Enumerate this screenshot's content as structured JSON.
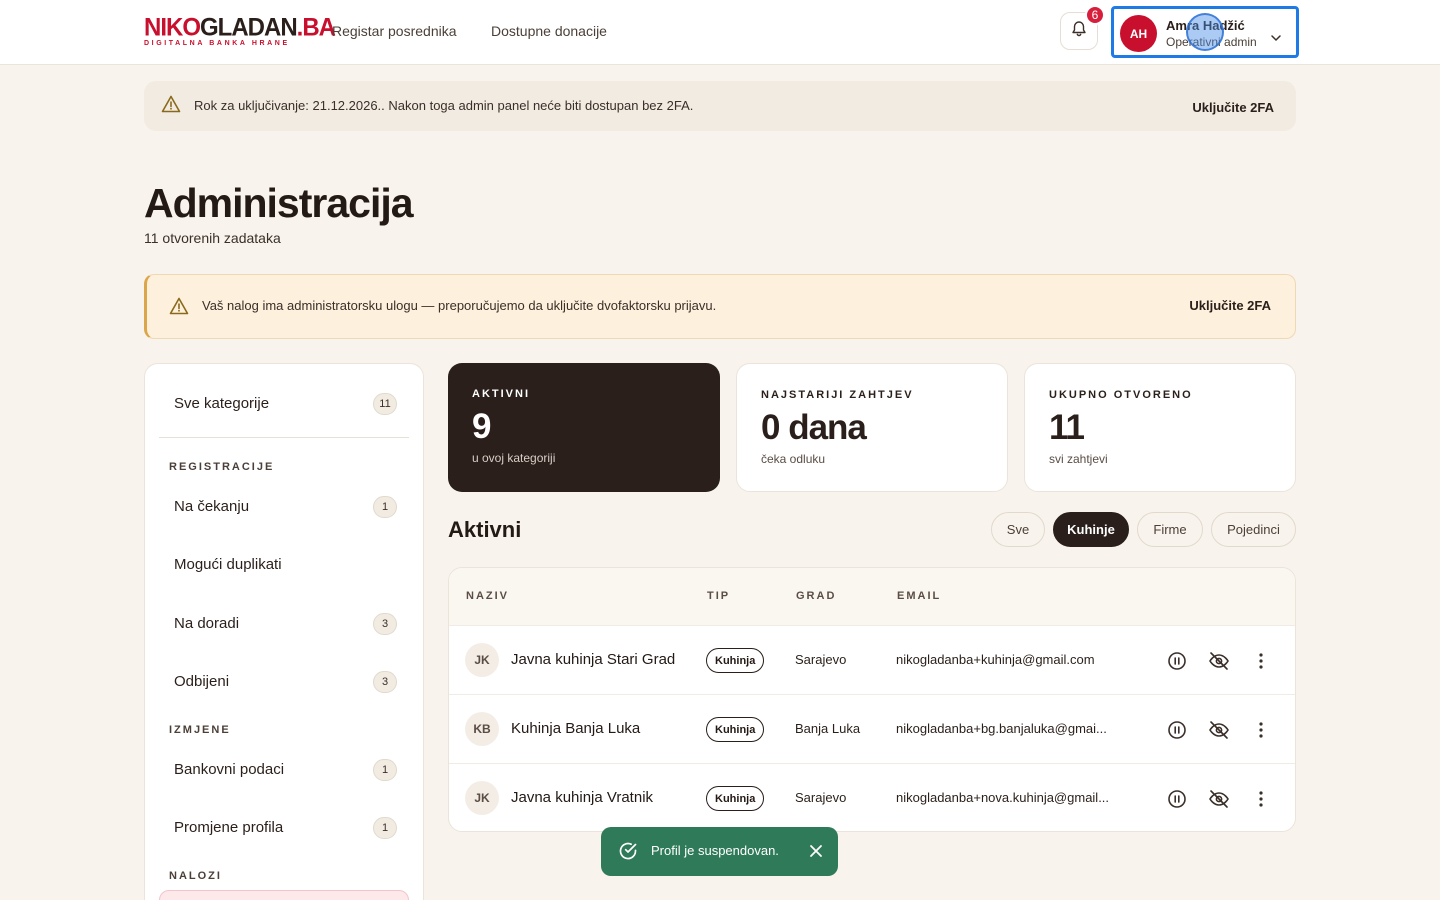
{
  "header": {
    "logo_main_red": "NIKO",
    "logo_main_dark": "GLADAN",
    "logo_main_tld": ".BA",
    "logo_sub": "DIGITALNA BANKA HRANE",
    "nav": [
      "Registar posrednika",
      "Dostupne donacije"
    ],
    "notifications_count": "6",
    "user": {
      "initials": "AH",
      "name": "Amra Hadžić",
      "role": "Operativni admin"
    }
  },
  "banner_top": {
    "text": "Rok za uključivanje: 21.12.2026.. Nakon toga admin panel neće biti dostupan bez 2FA.",
    "action": "Uključite 2FA"
  },
  "page": {
    "title": "Administracija",
    "subtitle": "11 otvorenih zadataka"
  },
  "banner_role": {
    "text": "Vaš nalog ima administratorsku ulogu — preporučujemo da uključite dvofaktorsku prijavu.",
    "action": "Uključite 2FA"
  },
  "sidebar": {
    "all": {
      "label": "Sve kategorije",
      "count": "11"
    },
    "sections": [
      {
        "title": "REGISTRACIJE",
        "items": [
          {
            "label": "Na čekanju",
            "count": "1"
          },
          {
            "label": "Mogući duplikati",
            "count": ""
          },
          {
            "label": "Na doradi",
            "count": "3"
          },
          {
            "label": "Odbijeni",
            "count": "3"
          }
        ]
      },
      {
        "title": "IZMJENE",
        "items": [
          {
            "label": "Bankovni podaci",
            "count": "1"
          },
          {
            "label": "Promjene profila",
            "count": "1"
          }
        ]
      },
      {
        "title": "NALOZI",
        "items": []
      }
    ]
  },
  "stats": [
    {
      "label": "AKTIVNI",
      "value": "9",
      "note": "u ovoj kategoriji"
    },
    {
      "label": "NAJSTARIJI ZAHTJEV",
      "value": "0 dana",
      "note": "čeka odluku"
    },
    {
      "label": "UKUPNO OTVORENO",
      "value": "11",
      "note": "svi zahtjevi"
    }
  ],
  "list": {
    "title": "Aktivni",
    "filters": [
      "Sve",
      "Kuhinje",
      "Firme",
      "Pojedinci"
    ],
    "active_filter": "Kuhinje",
    "columns": [
      "NAZIV",
      "TIP",
      "GRAD",
      "EMAIL"
    ],
    "rows": [
      {
        "initials": "JK",
        "name": "Javna kuhinja Stari Grad",
        "type": "Kuhinja",
        "city": "Sarajevo",
        "email": "nikogladanba+kuhinja@gmail.com"
      },
      {
        "initials": "KB",
        "name": "Kuhinja Banja Luka",
        "type": "Kuhinja",
        "city": "Banja Luka",
        "email": "nikogladanba+bg.banjaluka@gmai..."
      },
      {
        "initials": "JK",
        "name": "Javna kuhinja Vratnik",
        "type": "Kuhinja",
        "city": "Sarajevo",
        "email": "nikogladanba+nova.kuhinja@gmail..."
      }
    ],
    "row_actions": [
      "pause-icon",
      "eye-off-icon",
      "more-vertical-icon"
    ]
  },
  "toast": {
    "message": "Profil je suspendovan."
  },
  "colors": {
    "brand": "#c8102e",
    "dark": "#2a1f1a",
    "toast": "#2f7a58",
    "focus": "#1e7be6"
  }
}
